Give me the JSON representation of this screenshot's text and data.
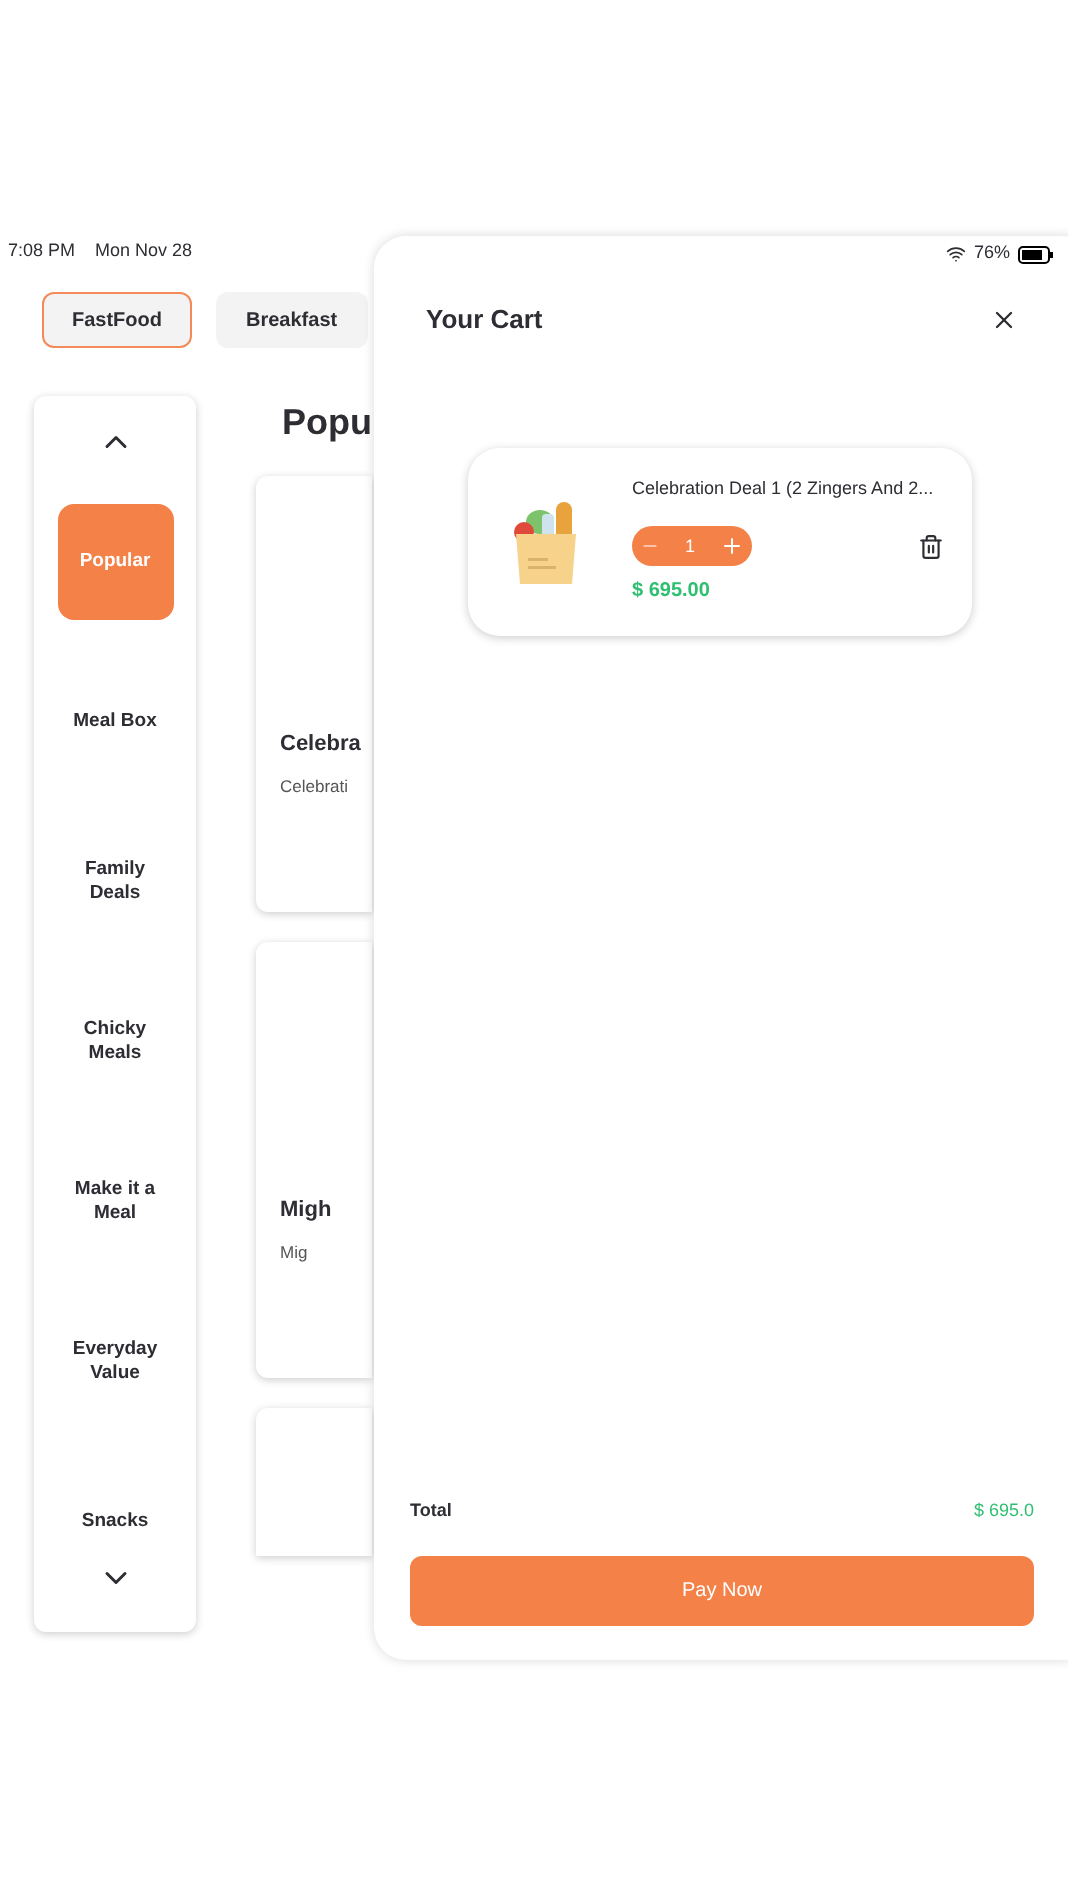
{
  "status_bar": {
    "time": "7:08 PM",
    "date": "Mon Nov 28",
    "battery": "76%"
  },
  "tabs": [
    {
      "label": "FastFood",
      "selected": true
    },
    {
      "label": "Breakfast",
      "selected": false
    }
  ],
  "sidebar": {
    "items": [
      {
        "label": "Popular",
        "selected": true
      },
      {
        "label": "Meal Box",
        "selected": false
      },
      {
        "label": "Family Deals",
        "selected": false
      },
      {
        "label": "Chicky Meals",
        "selected": false
      },
      {
        "label": "Make it a Meal",
        "selected": false
      },
      {
        "label": "Everyday Value",
        "selected": false
      },
      {
        "label": "Snacks",
        "selected": false
      }
    ]
  },
  "content": {
    "heading": "Popu",
    "cards": [
      {
        "title": "Celebra",
        "subtitle": "Celebrati"
      },
      {
        "title": "Migh",
        "subtitle": "Mig"
      }
    ]
  },
  "cart": {
    "title": "Your Cart",
    "items": [
      {
        "name": "Celebration Deal 1 (2 Zingers And 2...",
        "quantity": "1",
        "price": "$ 695.00"
      }
    ],
    "total_label": "Total",
    "total": "$ 695.0",
    "pay_button": "Pay Now"
  }
}
